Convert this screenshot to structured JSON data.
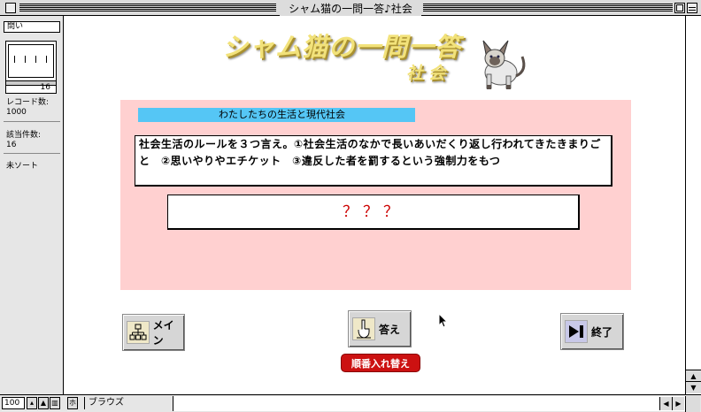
{
  "window": {
    "title": "シャム猫の一問一答♪社会"
  },
  "status_area": {
    "layout_name": "問い",
    "record_number": "16",
    "records_label": "レコード数:",
    "records_value": "1000",
    "found_label": "該当件数:",
    "found_value": "16",
    "sort_label": "未ソート"
  },
  "header": {
    "logo_title": "シャム猫の一問一答",
    "logo_subtitle": "社会"
  },
  "card": {
    "category": "わたしたちの生活と現代社会",
    "question": "社会生活のルールを３つ言え。①社会生活のなかで長いあいだくり返し行われてきたきまりごと　②思いやりやエチケット　③違反した者を罰するという強制力をもつ",
    "answer": "？？？"
  },
  "buttons": {
    "main_label": "メイン",
    "answer_label": "答え",
    "quit_label": "終了",
    "shuffle_label": "順番入れ替え"
  },
  "bottom_bar": {
    "zoom": "100",
    "mode": "ブラウズ"
  },
  "colors": {
    "panel": "#ffd0d0",
    "category_bar": "#55c6f5",
    "answer_text": "#cc0000",
    "shuffle_button": "#cc1111"
  },
  "icons": [
    "close-box-icon",
    "zoom-box-icon",
    "collapse-box-icon",
    "hierarchy-icon",
    "pen-hand-icon",
    "skip-end-icon",
    "siamese-cat-illustration",
    "pointer-cursor-icon"
  ]
}
